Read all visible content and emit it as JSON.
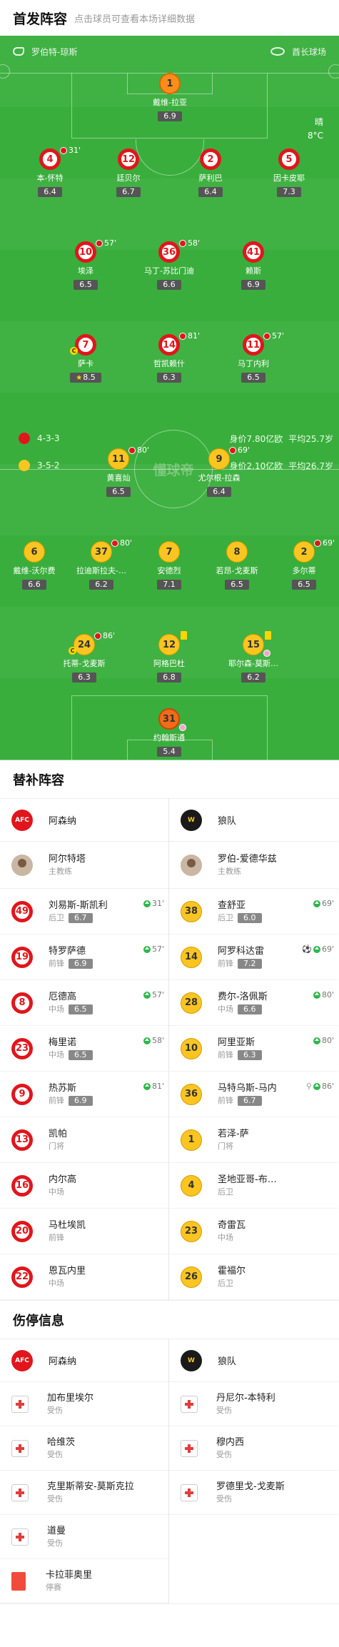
{
  "header": {
    "title": "首发阵容",
    "subtitle": "点击球员可查看本场详细数据"
  },
  "pitch": {
    "referee": "罗伯特-琼斯",
    "stadium": "酋长球场",
    "weather": "晴",
    "temperature": "8°C",
    "watermark": "懂球帝",
    "home": {
      "formation": "4-3-3",
      "value": "身价7.80亿欧",
      "age": "平均25.7岁"
    },
    "away": {
      "formation": "3-5-2",
      "value": "身价2.10亿欧",
      "age": "平均26.7岁"
    }
  },
  "home_players": [
    {
      "no": "1",
      "name": "戴维-拉亚",
      "rating": "6.9"
    },
    {
      "no": "4",
      "name": "本-怀特",
      "rating": "6.4",
      "sub": "31'"
    },
    {
      "no": "12",
      "name": "廷贝尔",
      "rating": "6.7"
    },
    {
      "no": "2",
      "name": "萨利巴",
      "rating": "6.4"
    },
    {
      "no": "5",
      "name": "因卡皮耶",
      "rating": "7.3"
    },
    {
      "no": "10",
      "name": "埃泽",
      "rating": "6.5",
      "sub": "57'"
    },
    {
      "no": "36",
      "name": "马丁-苏比门迪",
      "rating": "6.6",
      "sub": "58'"
    },
    {
      "no": "41",
      "name": "赖斯",
      "rating": "6.9"
    },
    {
      "no": "7",
      "name": "萨卡",
      "rating": "8.5",
      "cap": "C"
    },
    {
      "no": "14",
      "name": "哲凯赖什",
      "rating": "6.3",
      "sub": "81'"
    },
    {
      "no": "11",
      "name": "马丁内利",
      "rating": "6.5",
      "sub": "57'"
    }
  ],
  "away_players": [
    {
      "no": "11",
      "name": "黄喜灿",
      "rating": "6.5",
      "sub": "80'"
    },
    {
      "no": "9",
      "name": "尤尔根-拉森",
      "rating": "6.4",
      "sub": "69'"
    },
    {
      "no": "6",
      "name": "戴维-沃尔费",
      "rating": "6.6"
    },
    {
      "no": "37",
      "name": "拉迪斯拉夫-…",
      "rating": "6.2",
      "sub": "80'"
    },
    {
      "no": "7",
      "name": "安德烈",
      "rating": "7.1"
    },
    {
      "no": "8",
      "name": "若昂-戈麦斯",
      "rating": "6.5"
    },
    {
      "no": "2",
      "name": "多尔蒂",
      "rating": "6.5",
      "sub": "69'"
    },
    {
      "no": "24",
      "name": "托蒂-戈麦斯",
      "rating": "6.3",
      "sub": "86'",
      "cap": "C"
    },
    {
      "no": "12",
      "name": "阿格巴杜",
      "rating": "6.8"
    },
    {
      "no": "15",
      "name": "耶尔森-莫斯…",
      "rating": "6.2"
    },
    {
      "no": "31",
      "name": "约翰斯通",
      "rating": "5.4"
    }
  ],
  "subs": {
    "title": "替补阵容",
    "home_team": "阿森纳",
    "away_team": "狼队",
    "home_coach": {
      "name": "阿尔特塔",
      "role": "主教练"
    },
    "away_coach": {
      "name": "罗伯-爱德华兹",
      "role": "主教练"
    },
    "home": [
      {
        "no": "49",
        "name": "刘易斯-斯凯利",
        "pos": "后卫",
        "rating": "6.7",
        "time": "31'"
      },
      {
        "no": "19",
        "name": "特罗萨德",
        "pos": "前锋",
        "rating": "6.9",
        "time": "57'"
      },
      {
        "no": "8",
        "name": "厄德高",
        "pos": "中场",
        "rating": "6.5",
        "time": "57'"
      },
      {
        "no": "23",
        "name": "梅里诺",
        "pos": "中场",
        "rating": "6.5",
        "time": "58'"
      },
      {
        "no": "9",
        "name": "热苏斯",
        "pos": "前锋",
        "rating": "6.9",
        "time": "81'"
      },
      {
        "no": "13",
        "name": "凯帕",
        "pos": "门将"
      },
      {
        "no": "16",
        "name": "内尔高",
        "pos": "中场"
      },
      {
        "no": "20",
        "name": "马杜埃凯",
        "pos": "前锋"
      },
      {
        "no": "22",
        "name": "恩瓦内里",
        "pos": "中场"
      }
    ],
    "away": [
      {
        "no": "38",
        "name": "查舒亚",
        "pos": "后卫",
        "rating": "6.0",
        "time": "69'"
      },
      {
        "no": "14",
        "name": "阿罗科达雷",
        "pos": "前锋",
        "rating": "7.2",
        "time": "69'"
      },
      {
        "no": "28",
        "name": "费尔-洛佩斯",
        "pos": "中场",
        "rating": "6.6",
        "time": "80'"
      },
      {
        "no": "10",
        "name": "阿里亚斯",
        "pos": "前锋",
        "rating": "6.3",
        "time": "80'"
      },
      {
        "no": "36",
        "name": "马特乌斯-马内",
        "pos": "前锋",
        "rating": "6.7",
        "time": "86'"
      },
      {
        "no": "1",
        "name": "若泽-萨",
        "pos": "门将"
      },
      {
        "no": "4",
        "name": "圣地亚哥-布…",
        "pos": "后卫"
      },
      {
        "no": "23",
        "name": "奇雷瓦",
        "pos": "中场"
      },
      {
        "no": "26",
        "name": "霍福尔",
        "pos": "后卫"
      }
    ]
  },
  "injuries": {
    "title": "伤停信息",
    "home_team": "阿森纳",
    "away_team": "狼队",
    "home": [
      {
        "name": "加布里埃尔",
        "status": "受伤"
      },
      {
        "name": "哈维茨",
        "status": "受伤"
      },
      {
        "name": "克里斯蒂安-莫斯克拉",
        "status": "受伤"
      },
      {
        "name": "道曼",
        "status": "受伤"
      },
      {
        "name": "卡拉菲奥里",
        "status": "停赛"
      }
    ],
    "away": [
      {
        "name": "丹尼尔-本特利",
        "status": "受伤"
      },
      {
        "name": "穆内西",
        "status": "受伤"
      },
      {
        "name": "罗德里戈-戈麦斯",
        "status": "受伤"
      }
    ]
  }
}
